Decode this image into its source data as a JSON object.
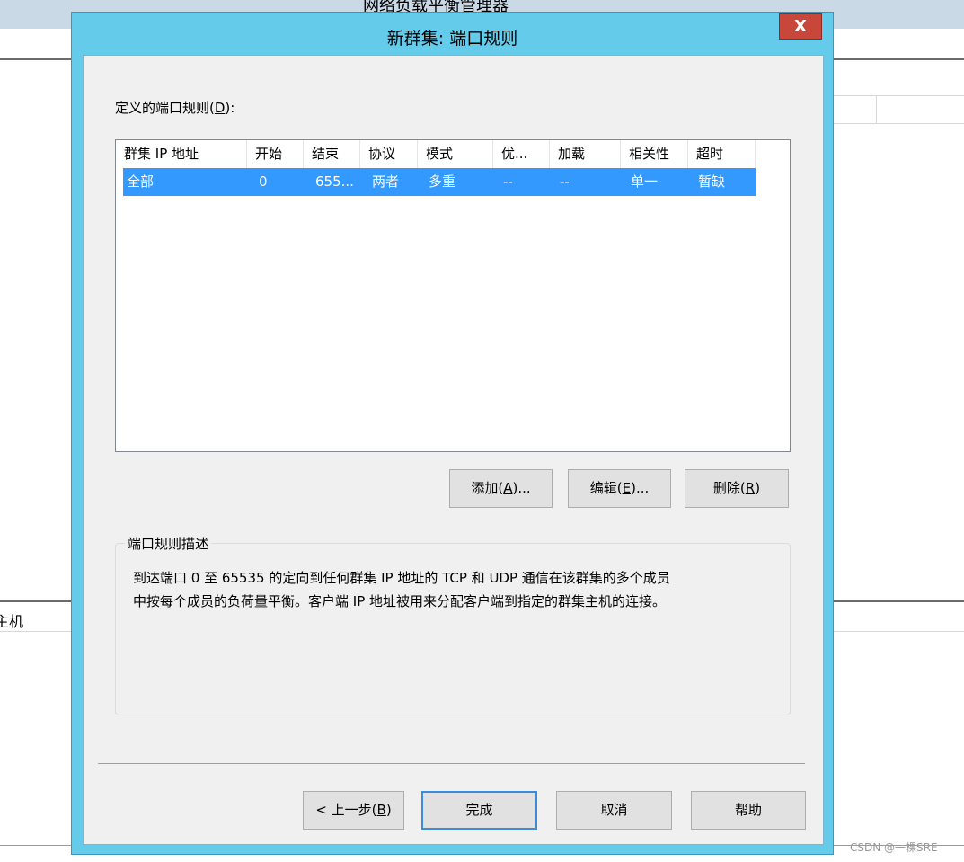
{
  "background": {
    "app_title": "网络负载平衡管理器",
    "host_label": "主机",
    "watermark": "CSDN @一棵SRE"
  },
  "dialog": {
    "title": "新群集: 端口规则",
    "close_label": "X",
    "rules_label_prefix": "定义的端口规则(",
    "rules_label_key": "D",
    "rules_label_suffix": "):",
    "columns": [
      "群集 IP 地址",
      "开始",
      "结束",
      "协议",
      "模式",
      "优...",
      "加载",
      "相关性",
      "超时"
    ],
    "rows": [
      [
        "全部",
        "0",
        "655...",
        "两者",
        "多重",
        "--",
        "--",
        "单一",
        "暂缺"
      ]
    ],
    "add_prefix": "添加(",
    "add_key": "A",
    "add_suffix": ")...",
    "edit_prefix": "编辑(",
    "edit_key": "E",
    "edit_suffix": ")...",
    "delete_prefix": "删除(",
    "delete_key": "R",
    "delete_suffix": ")",
    "description_title": "端口规则描述",
    "description_line1": "到达端口 0 至 65535 的定向到任何群集 IP 地址的 TCP 和 UDP 通信在该群集的多个成员",
    "description_line2": "中按每个成员的负荷量平衡。客户端 IP 地址被用来分配客户端到指定的群集主机的连接。",
    "back_prefix": "< 上一步(",
    "back_key": "B",
    "back_suffix": ")",
    "finish_label": "完成",
    "cancel_label": "取消",
    "help_label": "帮助"
  }
}
